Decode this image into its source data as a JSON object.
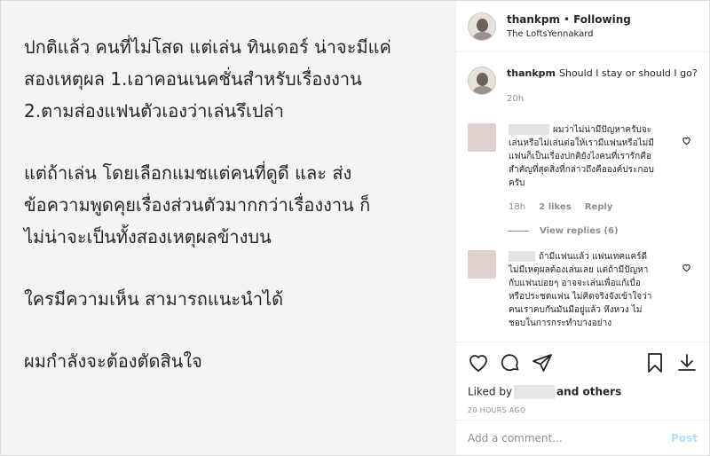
{
  "post_text": {
    "paragraphs": [
      "ปกติแล้ว คนที่ไม่โสด แต่เล่น ทินเดอร์ น่าจะมีแค่\nสองเหตุผล 1.เอาคอนเนคชั่นสำหรับเรื่องงาน\n2.ตามส่องแฟนตัวเองว่าเล่นรึเปล่า",
      "แต่ถ้าเล่น โดยเลือกแมชแต่คนที่ดูดี และ ส่ง\nข้อความพูดคุยเรื่องส่วนตัวมากกว่าเรื่องงาน ก็\nไม่น่าจะเป็นทั้งสองเหตุผลข้างบน",
      "ใครมีความเห็น สามารถแนะนำได้",
      "ผมกำลังจะต้องตัดสินใจ"
    ]
  },
  "header": {
    "username": "thankpm",
    "separator": "•",
    "follow_status": "Following",
    "location": "The LoftsYennakard"
  },
  "caption": {
    "username": "thankpm",
    "text": "Should I stay or should I go?",
    "time": "20h"
  },
  "comments": [
    {
      "text": "ผมว่าไม่น่ามีปัญหาครับจะเล่นหรือไม่เล่นต่อให้เรามีแฟนหรือไม่มีแฟนก็เป็นเรื่องปกติยังไงคนที่เรารักคือสำคัญที่สุดสิ่งที่กล่าวถึงคือองค์ประกอบครับ",
      "time": "18h",
      "likes": "2 likes",
      "reply": "Reply",
      "view_replies": "View replies (6)"
    },
    {
      "text": "ถ้ามีแฟนแล้ว แฟนเทคแคร์ดีไม่มีเหตุผลต้องเล่นเลย แต่ถ้ามีปัญหากับแฟนบ่อยๆ อาจจะเล่นเพื่อแก้เบื่อ หรือประชดแฟน ไม่คิดจริงจังเข้าใจว่า คนเราคบกันมันมีอยู่แล้ว หึงหวง ไม่ชอบในการกระทำบางอย่าง"
    }
  ],
  "likes": {
    "prefix": "Liked by",
    "suffix": "and others"
  },
  "timestamp": "20 HOURS AGO",
  "add_comment": {
    "placeholder": "Add a comment...",
    "post_label": "Post"
  }
}
